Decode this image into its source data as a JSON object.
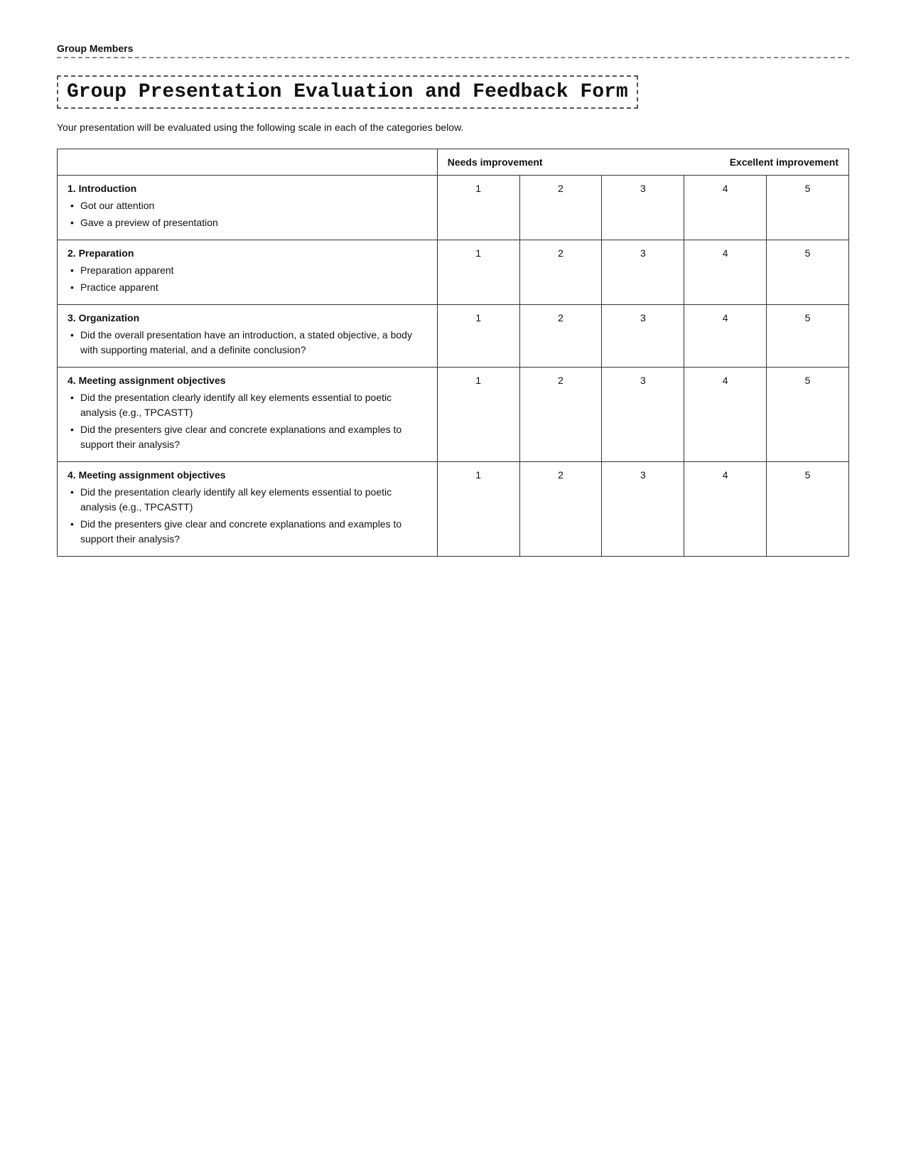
{
  "page": {
    "group_members_label": "Group Members",
    "title": "Group Presentation Evaluation and Feedback Form",
    "subtitle": "Your presentation will be evaluated using the following scale in each of the categories below.",
    "scale_header": {
      "needs_improvement": "Needs improvement",
      "excellent_improvement": "Excellent improvement"
    },
    "scale_numbers": [
      "1",
      "2",
      "3",
      "4",
      "5"
    ],
    "categories": [
      {
        "number": "1.",
        "title": "Introduction",
        "bullets": [
          "Got our attention",
          "Gave a preview of presentation"
        ]
      },
      {
        "number": "2.",
        "title": "Preparation",
        "bullets": [
          "Preparation apparent",
          "Practice apparent"
        ]
      },
      {
        "number": "3.",
        "title": "Organization",
        "bullets": [
          "Did the overall presentation have an introduction, a stated objective, a body with supporting material, and a definite conclusion?"
        ]
      },
      {
        "number": "4.",
        "title": "Meeting assignment objectives",
        "bullets": [
          "Did the presentation clearly identify all key elements essential to poetic analysis (e.g., TPCASTT)",
          "Did the presenters give clear and concrete explanations and examples to support their analysis?"
        ]
      },
      {
        "number": "4.",
        "title": "Meeting assignment objectives",
        "bullets": [
          "Did the presentation clearly identify all key elements essential to poetic analysis (e.g., TPCASTT)",
          "Did the presenters give clear and concrete explanations and examples to support their analysis?"
        ]
      }
    ]
  }
}
